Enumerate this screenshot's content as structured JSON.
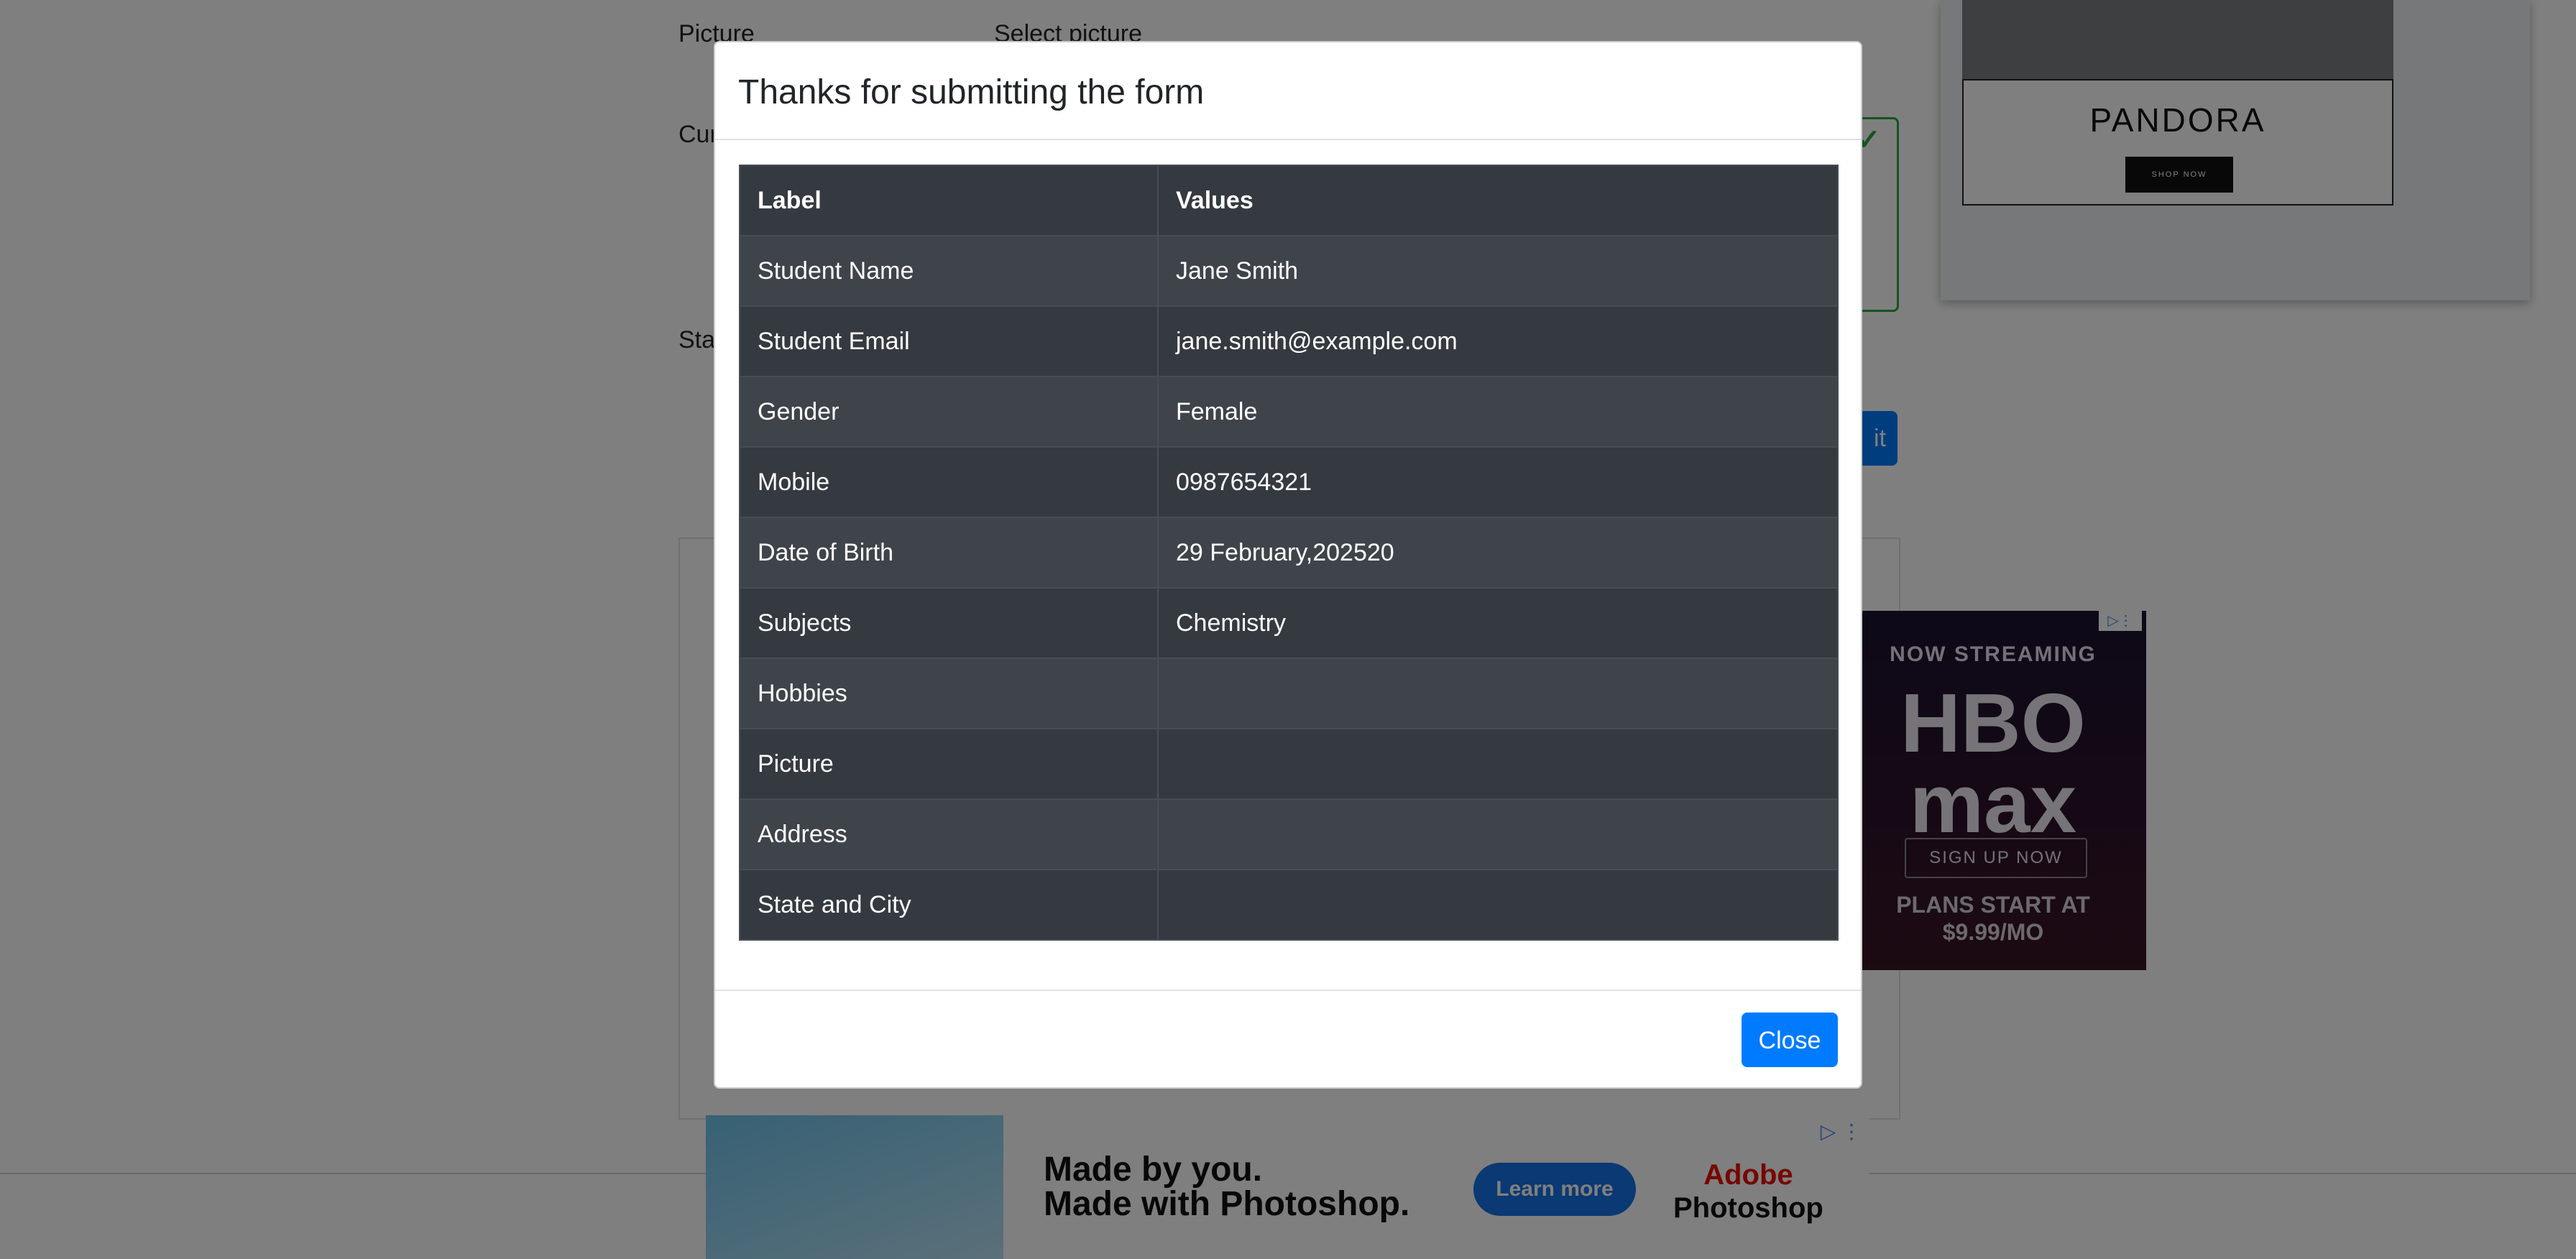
{
  "background": {
    "labels": {
      "picture": "Picture",
      "select_picture": "Select picture",
      "current_address_partial": "Cur",
      "state_partial": "Sta"
    },
    "submit_partial": "it",
    "pandora_ad": {
      "logo": "PANDORA",
      "button": "SHOP NOW"
    },
    "hbo_ad": {
      "line1": "NOW STREAMING",
      "logo_top": "HBO",
      "logo_bottom": "max",
      "button": "SIGN UP NOW",
      "plans_line1": "PLANS START AT",
      "plans_line2": "$9.99/MO"
    },
    "photoshop_ad": {
      "line1": "Made by you.",
      "line2": "Made with Photoshop.",
      "button": "Learn more",
      "brand_top": "Adobe",
      "brand_bottom": "Photoshop"
    }
  },
  "modal": {
    "title": "Thanks for submitting the form",
    "table": {
      "headers": [
        "Label",
        "Values"
      ],
      "rows": [
        {
          "label": "Student Name",
          "value": "Jane Smith"
        },
        {
          "label": "Student Email",
          "value": "jane.smith@example.com"
        },
        {
          "label": "Gender",
          "value": "Female"
        },
        {
          "label": "Mobile",
          "value": "0987654321"
        },
        {
          "label": "Date of Birth",
          "value": "29 February,202520"
        },
        {
          "label": "Subjects",
          "value": "Chemistry"
        },
        {
          "label": "Hobbies",
          "value": ""
        },
        {
          "label": "Picture",
          "value": ""
        },
        {
          "label": "Address",
          "value": ""
        },
        {
          "label": "State and City",
          "value": ""
        }
      ]
    },
    "close_label": "Close"
  },
  "colors": {
    "primary": "#007bff",
    "table_dark": "#343a40",
    "table_dark_stripe": "#3e444a",
    "valid_green": "#28a745"
  }
}
